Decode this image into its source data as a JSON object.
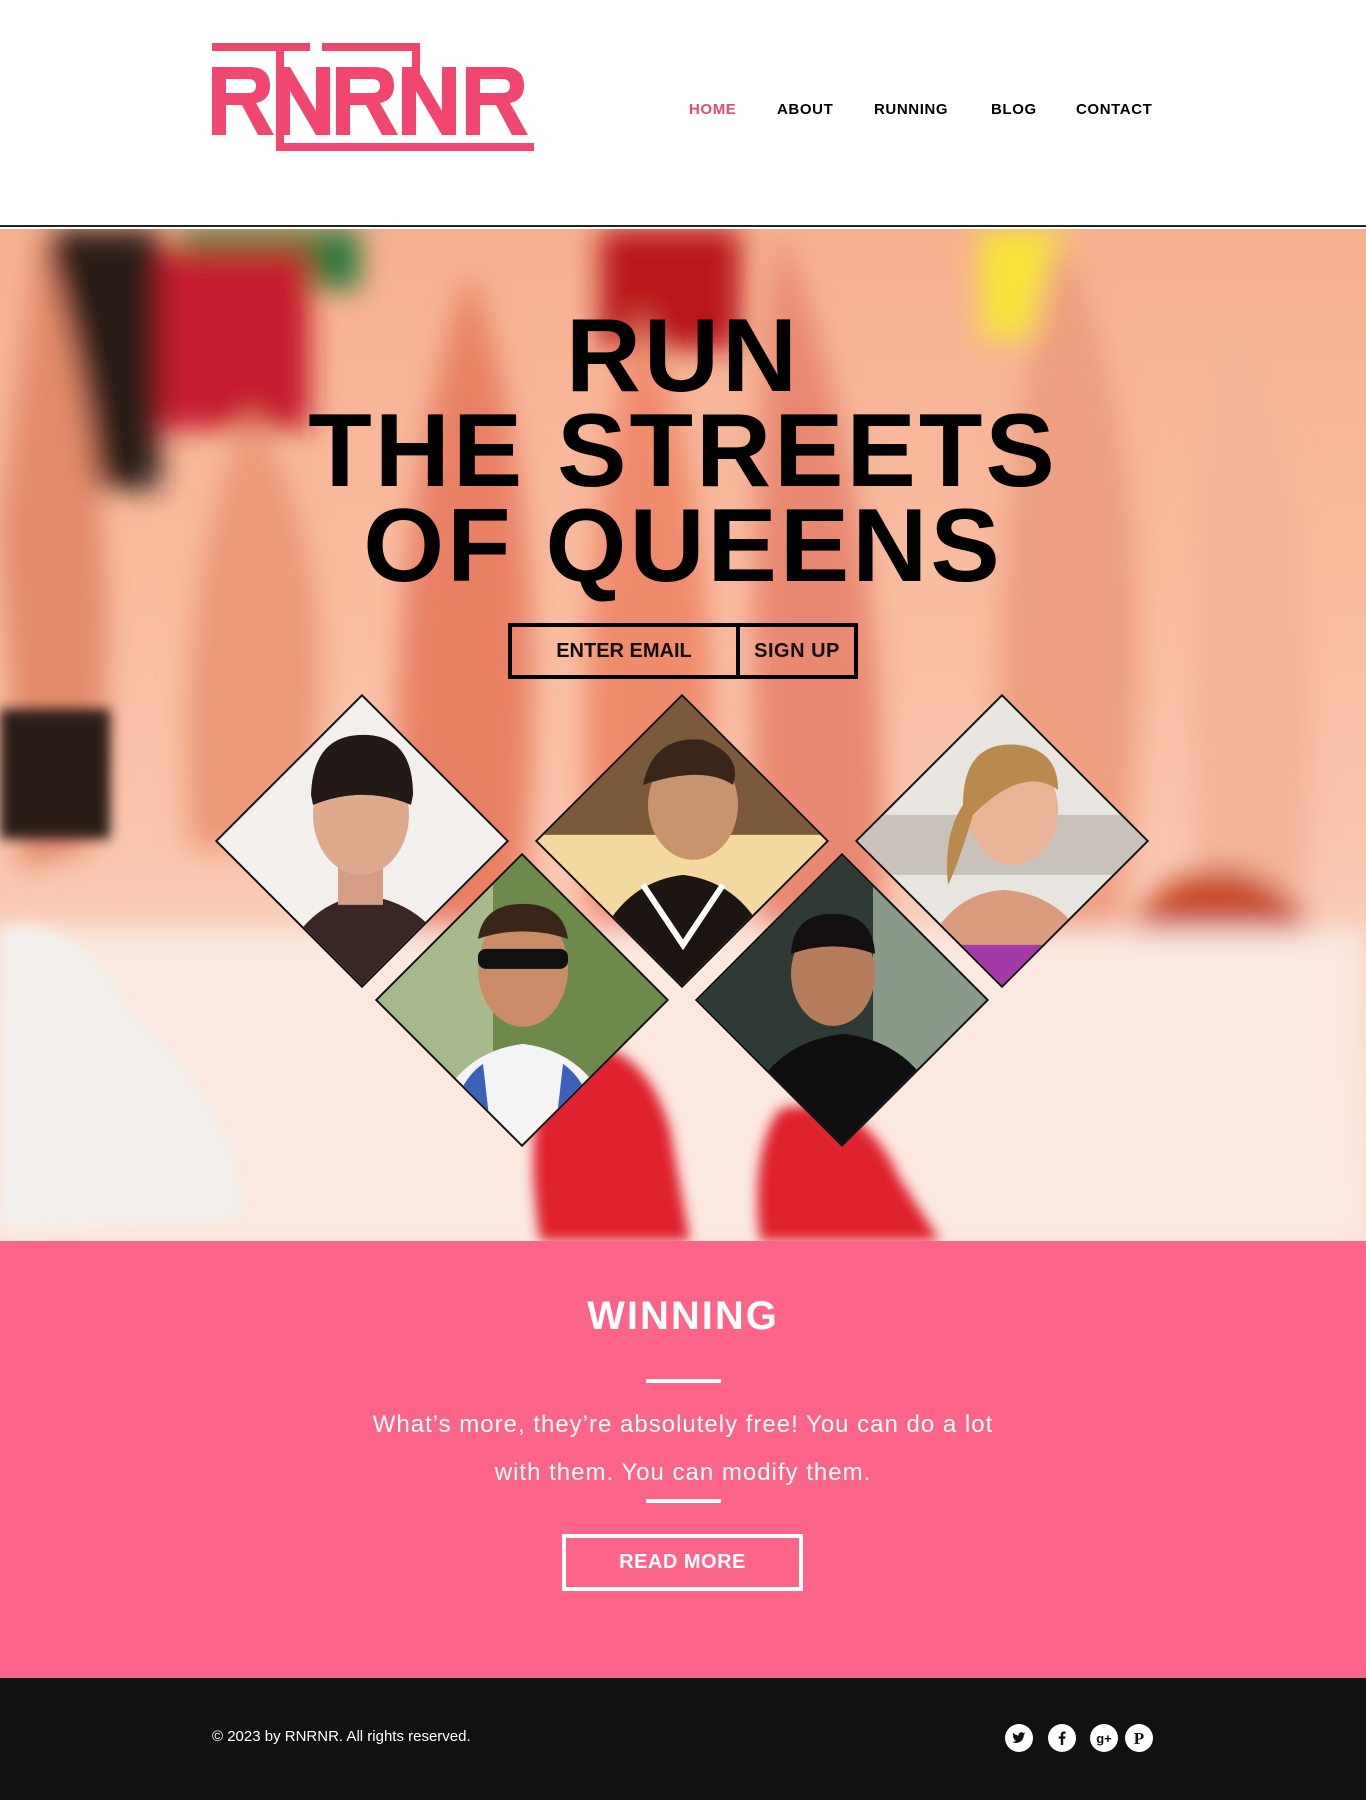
{
  "brand": {
    "logo_text": "RNRNR",
    "accent_color": "#f0466f"
  },
  "nav": {
    "items": [
      {
        "label": "HOME",
        "active": true
      },
      {
        "label": "ABOUT",
        "active": false
      },
      {
        "label": "RUNNING",
        "active": false
      },
      {
        "label": "BLOG",
        "active": false
      },
      {
        "label": "CONTACT",
        "active": false
      }
    ]
  },
  "hero": {
    "title_lines": [
      "RUN",
      "THE STREETS",
      "OF QUEENS"
    ],
    "email_placeholder": "ENTER EMAIL",
    "signup_label": "SIGN UP",
    "runner_photos": [
      "runner-man-beanie",
      "runner-woman-tank",
      "runner-woman-ponytail",
      "runner-man-sunglasses",
      "runner-man-black-shirt"
    ]
  },
  "winning": {
    "title": "WINNING",
    "text": "What’s more, they’re absolutely free! You can do a lot with them. You can modify them.",
    "button_label": "READ MORE",
    "background_color": "#fc6589"
  },
  "footer": {
    "copyright": "© 2023 by RNRNR. All rights reserved.",
    "social_icons": [
      "twitter-icon",
      "facebook-icon",
      "google-plus-icon",
      "pinterest-icon"
    ],
    "background_color": "#111111"
  }
}
